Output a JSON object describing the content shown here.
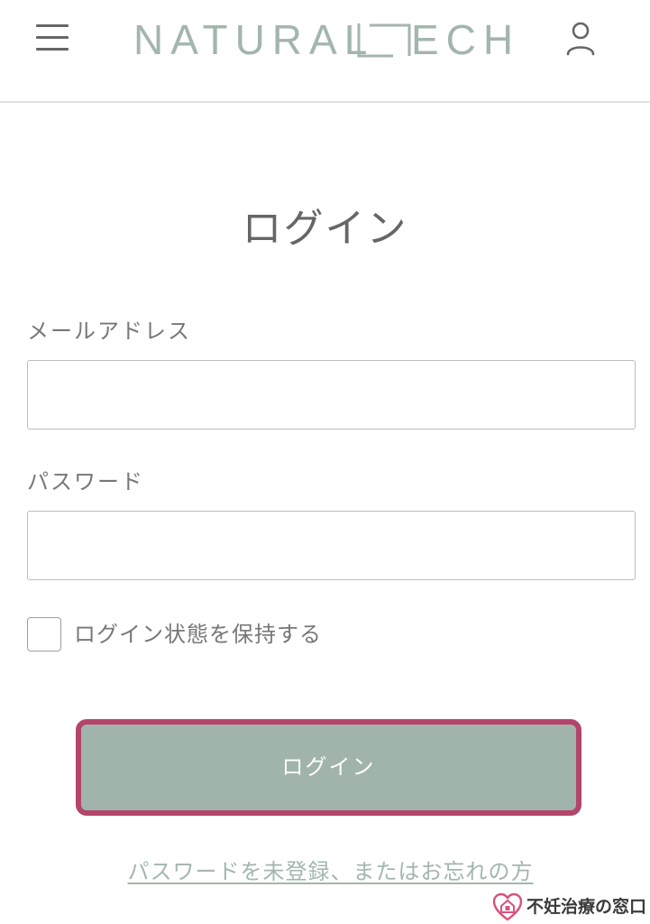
{
  "header": {
    "menu_icon": "hamburger-menu-icon",
    "logo_left": "NATURAL",
    "logo_right": "ECH",
    "logo_color": "#a3b6ad",
    "account_icon": "user-account-icon"
  },
  "login": {
    "title": "ログイン",
    "email_label": "メールアドレス",
    "email_value": "",
    "password_label": "パスワード",
    "password_value": "",
    "remember_label": "ログイン状態を保持する",
    "remember_checked": false,
    "submit_label": "ログイン",
    "forgot_link": "パスワードを未登録、またはお忘れの方"
  },
  "colors": {
    "accent": "#a1b4ac",
    "highlight_border": "#b3446b",
    "text": "#666666"
  },
  "watermark": {
    "icon": "heart-house-icon",
    "text": "不妊治療の窓口"
  }
}
